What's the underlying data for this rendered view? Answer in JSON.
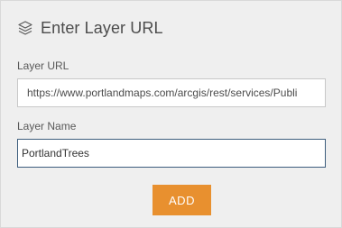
{
  "header": {
    "icon": "layers-icon",
    "title": "Enter Layer URL"
  },
  "form": {
    "layer_url": {
      "label": "Layer URL",
      "value": "https://www.portlandmaps.com/arcgis/rest/services/Publi"
    },
    "layer_name": {
      "label": "Layer Name",
      "value": "PortlandTrees"
    },
    "add_label": "ADD"
  },
  "colors": {
    "panel_background": "#efefef",
    "accent_button": "#e8902f",
    "focused_border": "#3d5d7d"
  }
}
